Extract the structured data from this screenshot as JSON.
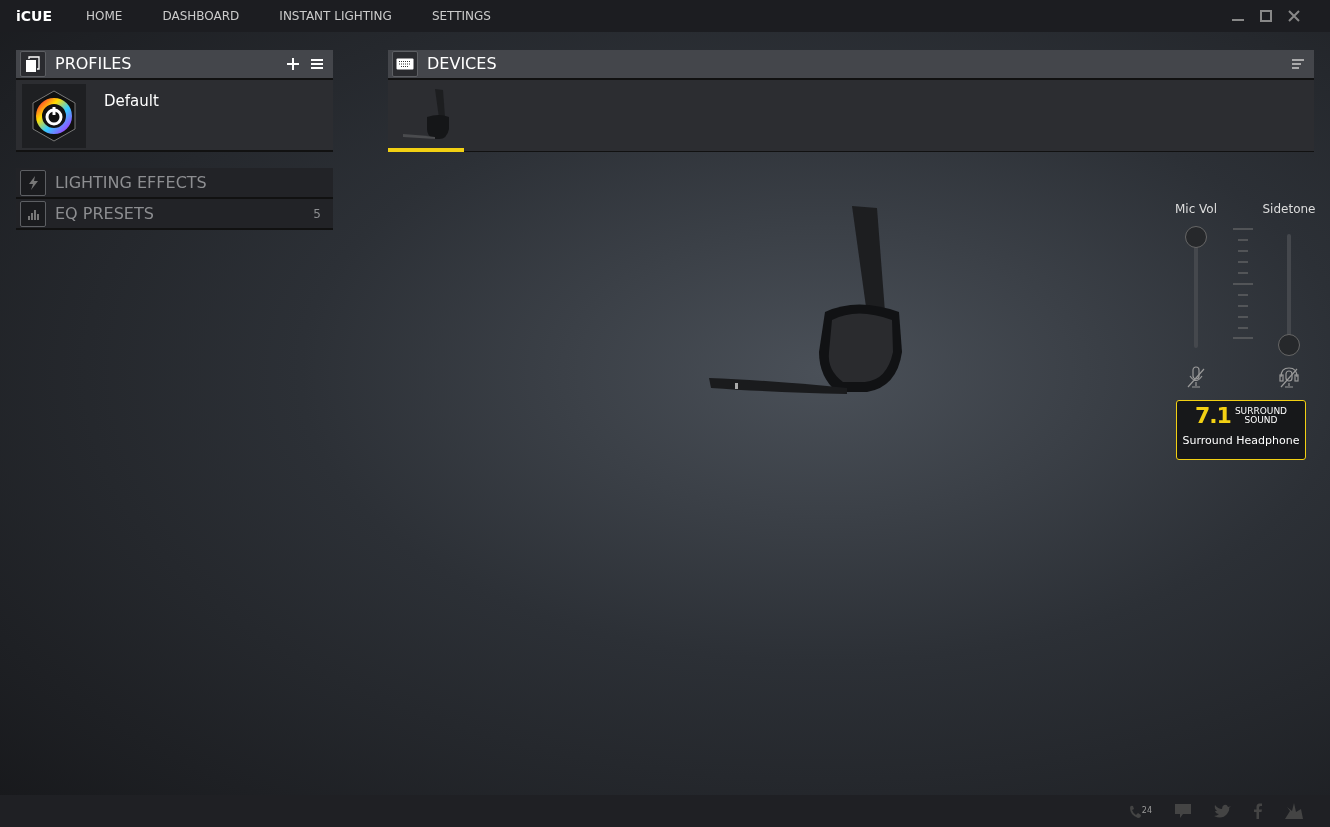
{
  "app": {
    "logo": "iCUE"
  },
  "nav": [
    {
      "label": "HOME"
    },
    {
      "label": "DASHBOARD"
    },
    {
      "label": "INSTANT LIGHTING"
    },
    {
      "label": "SETTINGS"
    }
  ],
  "profiles": {
    "title": "PROFILES",
    "items": [
      {
        "name": "Default"
      }
    ]
  },
  "sections": [
    {
      "kind": "lighting",
      "label": "LIGHTING EFFECTS"
    },
    {
      "kind": "eq",
      "label": "EQ PRESETS",
      "count": "5"
    }
  ],
  "devices": {
    "title": "DEVICES",
    "items": [
      {
        "selected": true
      }
    ]
  },
  "sliders": [
    {
      "kind": "mic",
      "label": "Mic Vol",
      "level": 1
    },
    {
      "kind": "sidetone",
      "label": "Sidetone",
      "level": 0
    }
  ],
  "surround": {
    "number": "7.1",
    "line_1": "SURROUND",
    "line_2": "SOUND",
    "mode": "Surround Headphone",
    "on": true
  },
  "footer": {
    "support_hours": "24"
  }
}
